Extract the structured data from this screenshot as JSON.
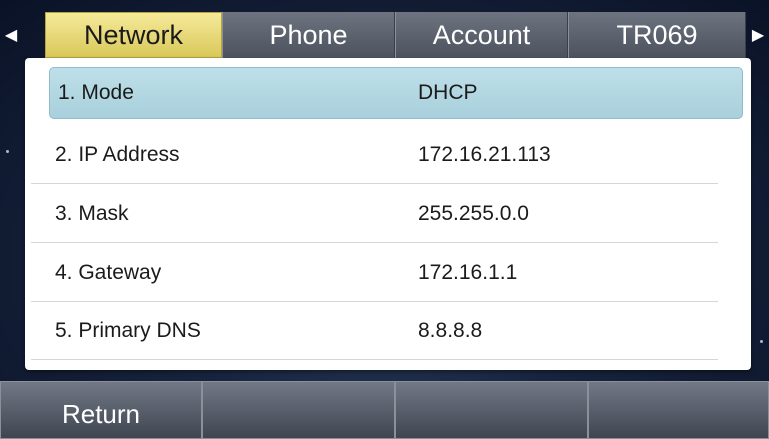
{
  "tabs": [
    {
      "label": "Network",
      "active": true
    },
    {
      "label": "Phone",
      "active": false
    },
    {
      "label": "Account",
      "active": false
    },
    {
      "label": "TR069",
      "active": false
    }
  ],
  "rows": [
    {
      "label": "1. Mode",
      "value": "DHCP",
      "selected": true
    },
    {
      "label": "2. IP Address",
      "value": "172.16.21.113",
      "selected": false
    },
    {
      "label": "3. Mask",
      "value": "255.255.0.0",
      "selected": false
    },
    {
      "label": "4. Gateway",
      "value": "172.16.1.1",
      "selected": false
    },
    {
      "label": "5. Primary  DNS",
      "value": "8.8.8.8",
      "selected": false
    }
  ],
  "softkeys": [
    "Return",
    "",
    "",
    ""
  ],
  "icons": {
    "left": "triangle-left-icon",
    "right": "triangle-right-icon"
  },
  "colors": {
    "active_tab": "#eadf7b",
    "selection": "#b5d9e3"
  }
}
